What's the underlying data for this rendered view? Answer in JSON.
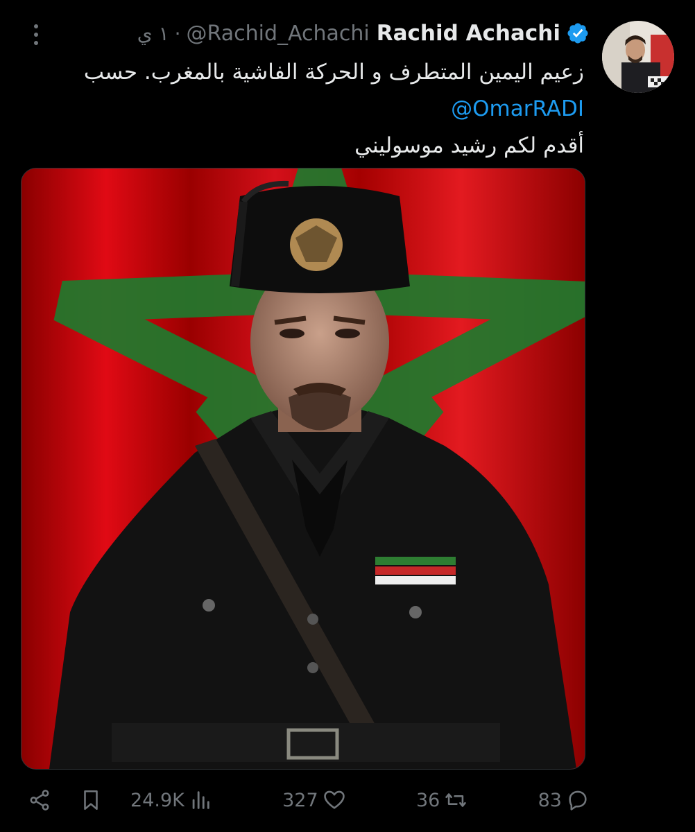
{
  "tweet": {
    "display_name": "Rachid Achachi",
    "handle": "@Rachid_Achachi",
    "separator": "·",
    "timestamp": "١ ي",
    "text_line1": "زعيم اليمين المتطرف و الحركة الفاشية بالمغرب. حسب",
    "mention": "@OmarRADI",
    "text_line2": "أقدم لكم رشيد موسوليني"
  },
  "icons": {
    "more": "more-vertical-icon",
    "verified": "verified-badge-icon",
    "share": "share-icon",
    "bookmark": "bookmark-icon",
    "views": "analytics-icon",
    "like": "heart-icon",
    "retweet": "retweet-icon",
    "reply": "reply-icon"
  },
  "metrics": {
    "views": "24.9K",
    "likes": "327",
    "retweets": "36",
    "replies": "83"
  },
  "colors": {
    "background": "#000000",
    "text": "#e7e9ea",
    "muted": "#71767b",
    "link": "#1d9bf0",
    "verified": "#1d9bf0",
    "flag_red": "#c1121f",
    "flag_green": "#1f7a2e"
  }
}
